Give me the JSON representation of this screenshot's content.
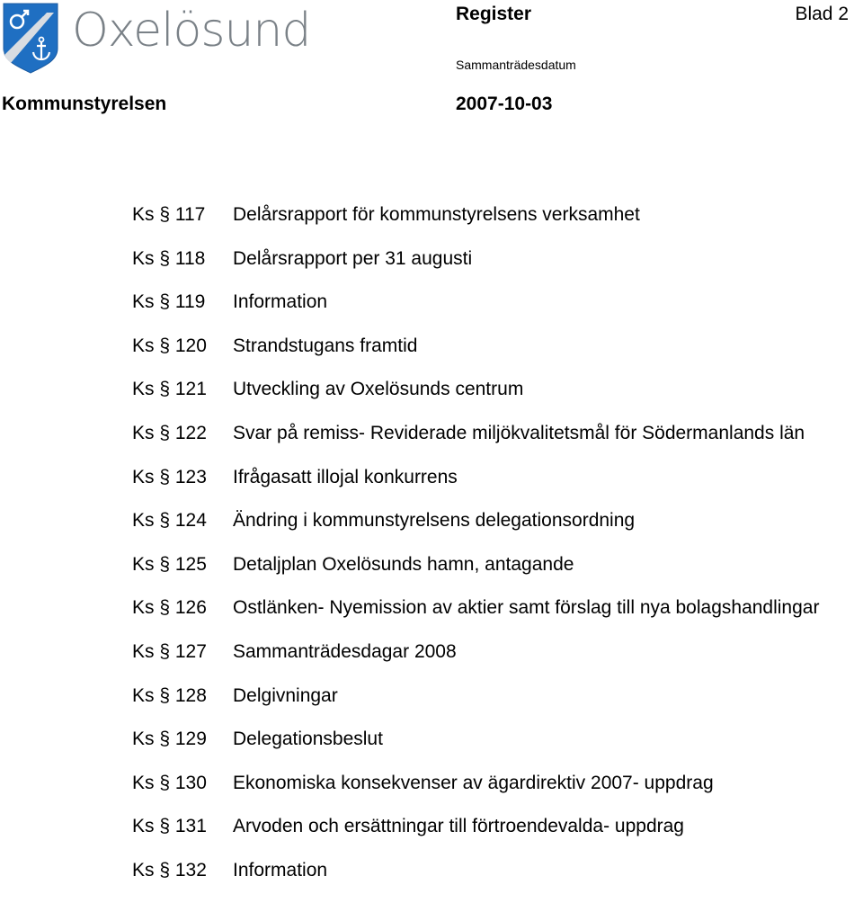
{
  "header": {
    "logo_text": "Oxelösund",
    "doc_type": "Register",
    "page_label": "Blad 2",
    "date_label": "Sammanträdesdatum",
    "organization": "Kommunstyrelsen",
    "meeting_date": "2007-10-03"
  },
  "colors": {
    "shield_blue": "#1f6fc2",
    "logo_grey": "#7a8187"
  },
  "icons": {
    "crest": "coat-of-arms-shield (mars symbol + anchor)"
  },
  "items": [
    {
      "ref": "Ks § 117",
      "title": "Delårsrapport för kommunstyrelsens verksamhet"
    },
    {
      "ref": "Ks § 118",
      "title": "Delårsrapport per 31 augusti"
    },
    {
      "ref": "Ks § 119",
      "title": "Information"
    },
    {
      "ref": "Ks § 120",
      "title": "Strandstugans framtid"
    },
    {
      "ref": "Ks § 121",
      "title": "Utveckling av Oxelösunds centrum"
    },
    {
      "ref": "Ks § 122",
      "title": "Svar på remiss- Reviderade miljökvalitetsmål för Södermanlands län"
    },
    {
      "ref": "Ks § 123",
      "title": "Ifrågasatt illojal konkurrens"
    },
    {
      "ref": "Ks § 124",
      "title": "Ändring i kommunstyrelsens delegationsordning"
    },
    {
      "ref": "Ks § 125",
      "title": "Detaljplan Oxelösunds hamn, antagande"
    },
    {
      "ref": "Ks § 126",
      "title": "Ostlänken- Nyemission av aktier samt förslag till nya bolagshandlingar"
    },
    {
      "ref": "Ks § 127",
      "title": "Sammanträdesdagar 2008"
    },
    {
      "ref": "Ks § 128",
      "title": "Delgivningar"
    },
    {
      "ref": "Ks § 129",
      "title": "Delegationsbeslut"
    },
    {
      "ref": "Ks § 130",
      "title": "Ekonomiska konsekvenser av ägardirektiv 2007- uppdrag"
    },
    {
      "ref": "Ks § 131",
      "title": "Arvoden och ersättningar till förtroendevalda- uppdrag"
    },
    {
      "ref": "Ks § 132",
      "title": "Information"
    }
  ]
}
